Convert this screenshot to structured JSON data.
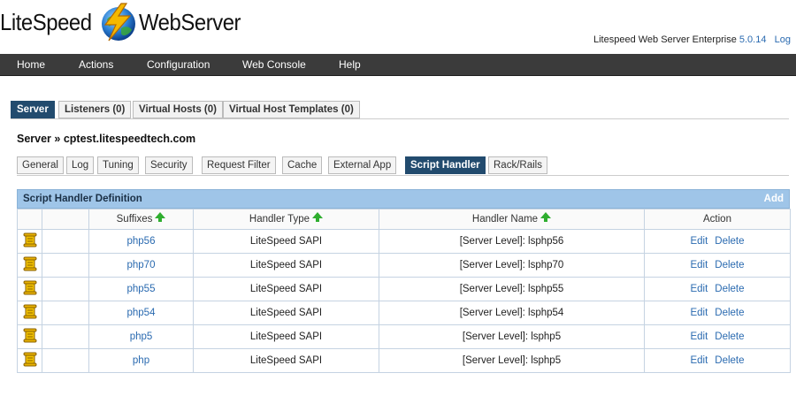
{
  "header": {
    "logo_left": "LiteSpeed",
    "logo_right": "WebServer",
    "product": "Litespeed Web Server Enterprise",
    "version": "5.0.14",
    "logout": "Log"
  },
  "nav": [
    "Home",
    "Actions",
    "Configuration",
    "Web Console",
    "Help"
  ],
  "server_tabs": [
    {
      "label": "Server",
      "active": true
    },
    {
      "label": "Listeners (0)",
      "active": false
    },
    {
      "label": "Virtual Hosts (0)",
      "active": false
    },
    {
      "label": "Virtual Host Templates (0)",
      "active": false
    }
  ],
  "breadcrumb": "Server » cptest.litespeedtech.com",
  "sub_tabs": [
    {
      "label": "General",
      "active": false
    },
    {
      "label": "Log",
      "active": false
    },
    {
      "label": "Tuning",
      "active": false
    },
    {
      "label": "Security",
      "active": false
    },
    {
      "label": "Request Filter",
      "active": false
    },
    {
      "label": "Cache",
      "active": false
    },
    {
      "label": "External App",
      "active": false
    },
    {
      "label": "Script Handler",
      "active": true
    },
    {
      "label": "Rack/Rails",
      "active": false
    }
  ],
  "table": {
    "title": "Script Handler Definition",
    "add_label": "Add",
    "columns": [
      "Suffixes",
      "Handler Type",
      "Handler Name",
      "Action"
    ],
    "edit_label": "Edit",
    "delete_label": "Delete",
    "rows": [
      {
        "suffix": "php56",
        "type": "LiteSpeed SAPI",
        "name": "[Server Level]: lsphp56"
      },
      {
        "suffix": "php70",
        "type": "LiteSpeed SAPI",
        "name": "[Server Level]: lsphp70"
      },
      {
        "suffix": "php55",
        "type": "LiteSpeed SAPI",
        "name": "[Server Level]: lsphp55"
      },
      {
        "suffix": "php54",
        "type": "LiteSpeed SAPI",
        "name": "[Server Level]: lsphp54"
      },
      {
        "suffix": "php5",
        "type": "LiteSpeed SAPI",
        "name": "[Server Level]: lsphp5"
      },
      {
        "suffix": "php",
        "type": "LiteSpeed SAPI",
        "name": "[Server Level]: lsphp5"
      }
    ]
  },
  "colors": {
    "navbar": "#3b3b3b",
    "active_tab": "#224b6e",
    "table_header": "#9fc5e8",
    "link": "#2a6ab0",
    "sort_arrow": "#2fae2f",
    "row_icon": "#e8b100"
  },
  "icons": {
    "sort": "sort-arrow-up-icon",
    "row": "script-scroll-icon",
    "logo": "lightning-globe-icon"
  }
}
